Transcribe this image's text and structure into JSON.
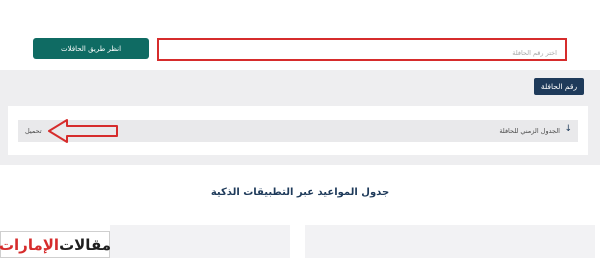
{
  "header": {
    "route_button_label": "انظر طريق الحافلات",
    "search_placeholder": "اختر رقم الحافلة",
    "search_value": ""
  },
  "panel": {
    "bus_number_label": "رقم الحافلة",
    "schedule_label": "الجدول الزمني للحافلة",
    "download_label": "تحميل"
  },
  "section": {
    "title": "جدول المواعيد عبر التطبيقات الذكية"
  },
  "watermark": {
    "part1": "مقالات",
    "part2": "الإمارات"
  },
  "colors": {
    "accent_green": "#0f6b63",
    "navy": "#1e3a5a",
    "highlight_red": "#d62c2c"
  },
  "icons": [
    "down-arrow-icon",
    "red-pointer-arrow-icon"
  ]
}
